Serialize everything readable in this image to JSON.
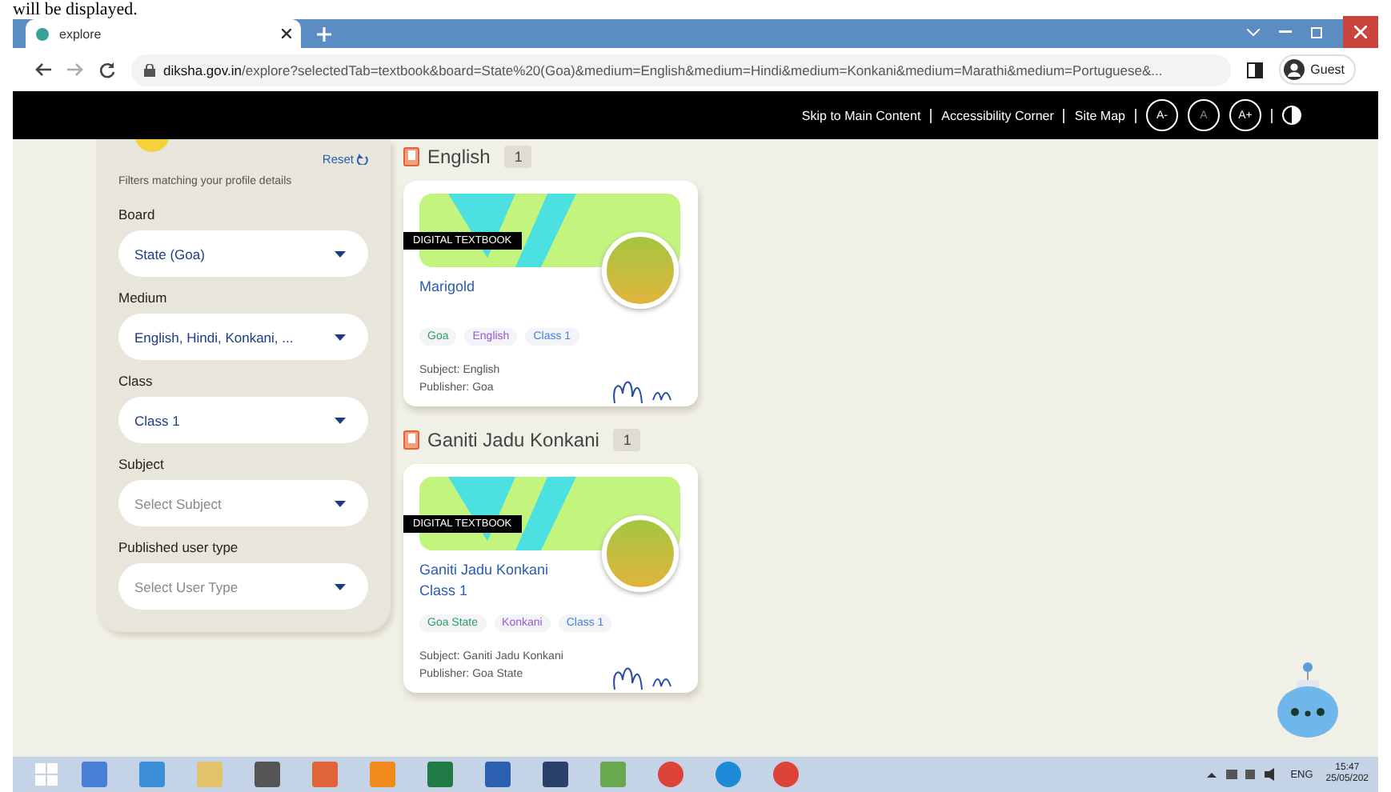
{
  "document_fragment": "will be displayed.",
  "browser": {
    "tab": {
      "title": "explore"
    },
    "url": {
      "domain": "diksha.gov.in",
      "path": "/explore?selectedTab=textbook&board=State%20(Goa)&medium=English&medium=Hindi&medium=Konkani&medium=Marathi&medium=Portuguese&..."
    },
    "profile": "Guest"
  },
  "header": {
    "links": [
      "Skip to Main Content",
      "Accessibility Corner",
      "Site Map"
    ],
    "font_buttons": [
      "A-",
      "A",
      "A+"
    ]
  },
  "filters": {
    "reset": "Reset",
    "hint": "Filters matching your profile details",
    "fields": [
      {
        "label": "Board",
        "value": "State (Goa)"
      },
      {
        "label": "Medium",
        "value": "English, Hindi, Konkani, ..."
      },
      {
        "label": "Class",
        "value": "Class 1"
      },
      {
        "label": "Subject",
        "placeholder": "Select Subject"
      },
      {
        "label": "Published user type",
        "placeholder": "Select User Type"
      }
    ]
  },
  "sections": [
    {
      "title": "English",
      "count": "1",
      "cards": [
        {
          "badge": "DIGITAL TEXTBOOK",
          "title": "Marigold",
          "tags": [
            {
              "text": "Goa",
              "color": "#2e9e5e"
            },
            {
              "text": "English",
              "color": "#9b59d0"
            },
            {
              "text": "Class 1",
              "color": "#4a7fd6"
            }
          ],
          "subject": "Subject: English",
          "publisher": "Publisher: Goa"
        }
      ]
    },
    {
      "title": "Ganiti Jadu Konkani",
      "count": "1",
      "cards": [
        {
          "badge": "DIGITAL TEXTBOOK",
          "title": "Ganiti Jadu Konkani Class 1",
          "tags": [
            {
              "text": "Goa State",
              "color": "#2e9e5e"
            },
            {
              "text": "Konkani",
              "color": "#9b59d0"
            },
            {
              "text": "Class 1",
              "color": "#4a7fd6"
            }
          ],
          "subject": "Subject: Ganiti Jadu Konkani",
          "publisher": "Publisher: Goa State"
        }
      ]
    }
  ],
  "taskbar": {
    "language": "ENG",
    "time": "15:47",
    "date": "25/05/202"
  }
}
